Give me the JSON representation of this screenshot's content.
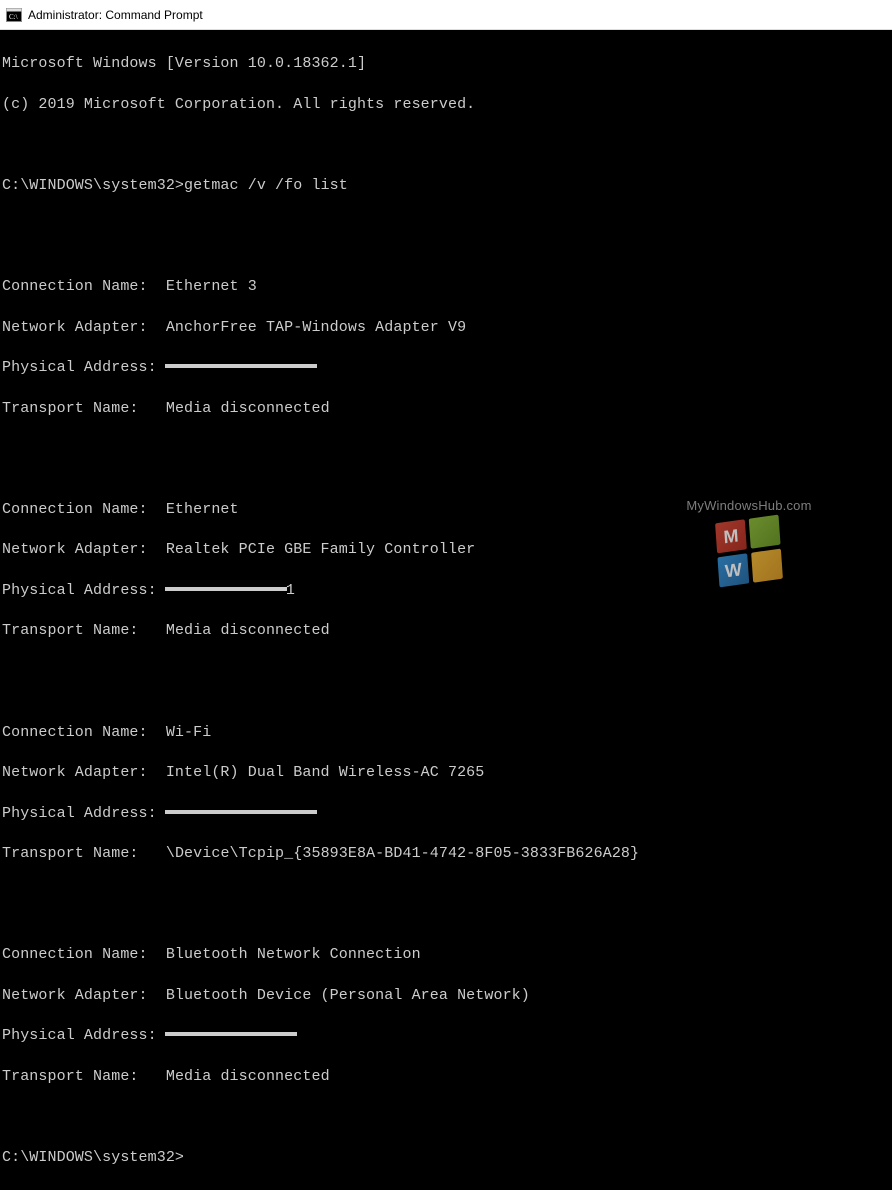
{
  "window": {
    "title": "Administrator: Command Prompt"
  },
  "header": {
    "line1": "Microsoft Windows [Version 10.0.18362.1]",
    "line2": "(c) 2019 Microsoft Corporation. All rights reserved."
  },
  "prompt": {
    "path": "C:\\WINDOWS\\system32>",
    "command": "getmac /v /fo list",
    "final_path": "C:\\WINDOWS\\system32>"
  },
  "labels": {
    "connection_name": "Connection Name:",
    "network_adapter": "Network Adapter:",
    "physical_address": "Physical Address:",
    "transport_name": "Transport Name:"
  },
  "entries": [
    {
      "connection_name": "Ethernet 3",
      "network_adapter": "AnchorFree TAP-Windows Adapter V9",
      "physical_address_redacted": true,
      "physical_address_suffix": "",
      "transport_name": "Media disconnected"
    },
    {
      "connection_name": "Ethernet",
      "network_adapter": "Realtek PCIe GBE Family Controller",
      "physical_address_redacted": true,
      "physical_address_suffix": "1",
      "transport_name": "Media disconnected"
    },
    {
      "connection_name": "Wi-Fi",
      "network_adapter": "Intel(R) Dual Band Wireless-AC 7265",
      "physical_address_redacted": true,
      "physical_address_suffix": "",
      "transport_name": "\\Device\\Tcpip_{35893E8A-BD41-4742-8F05-3833FB626A28}"
    },
    {
      "connection_name": "Bluetooth Network Connection",
      "network_adapter": "Bluetooth Device (Personal Area Network)",
      "physical_address_redacted": true,
      "physical_address_suffix": "",
      "transport_name": "Media disconnected"
    }
  ],
  "watermark": {
    "text": "MyWindowsHub.com",
    "letter1": "M",
    "letter2": "W"
  }
}
